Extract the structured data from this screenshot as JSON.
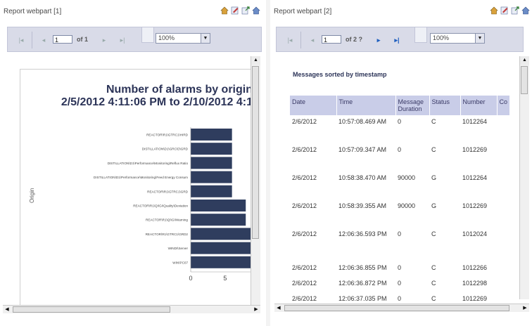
{
  "webpart1": {
    "title": "Report webpart [1]",
    "toolbar": {
      "first": "|◂",
      "prev": "◂",
      "page_value": "1",
      "of_label": "of 1",
      "next": "▸",
      "last": "▸|",
      "zoom": "100%"
    },
    "chart_data": {
      "type": "bar",
      "orientation": "horizontal",
      "title": "Number of alarms by origin",
      "subtitle": "2/5/2012 4:11:06 PM to 2/10/2012 4:1",
      "ylabel": "Origin",
      "categories": [
        "REACTOR\\R1\\GTRC1\\HIRD",
        "DISTILLATION\\D1\\GRC\\D\\GRD",
        "DISTILLATION\\D1\\Performance\\Monitoring\\Reflux Ratio",
        "DISTILLATION\\D1\\Performance\\Monitoring\\Feed Energy Consum",
        "REACTOR\\R1\\GTRC1\\GRD",
        "REACTOR\\R1\\QI\\GI\\Quality\\Deviation",
        "REACTOR\\R1\\QI\\GI\\Warning",
        "REACTOR\\R1\\GTRC1\\GRD2",
        "WINDI\\Server",
        "WIN\\PC07"
      ],
      "values": [
        6,
        6,
        6,
        6,
        6,
        8,
        8,
        9,
        9,
        9
      ],
      "xticks": [
        "0",
        "5"
      ],
      "xlim": [
        0,
        9
      ],
      "bar_color": "#2f3d5e"
    }
  },
  "webpart2": {
    "title": "Report webpart [2]",
    "toolbar": {
      "first": "|◂",
      "prev": "◂",
      "page_value": "1",
      "of_label": "of 2 ?",
      "next": "▸",
      "last": "▸|",
      "zoom": "100%"
    },
    "report_title": "Messages sorted by timestamp",
    "table": {
      "headers": [
        "Date",
        "Time",
        "Message Duration",
        "Status",
        "Number",
        "Co"
      ],
      "rows": [
        [
          "2/6/2012",
          "10:57:08.469 AM",
          "0",
          "C",
          "1012264"
        ],
        [
          "2/6/2012",
          "10:57:09.347 AM",
          "0",
          "C",
          "1012269"
        ],
        [
          "2/6/2012",
          "10:58:38.470 AM",
          "90000",
          "G",
          "1012264"
        ],
        [
          "2/6/2012",
          "10:58:39.355 AM",
          "90000",
          "G",
          "1012269"
        ],
        [
          "2/6/2012",
          "12:06:36.593 PM",
          "0",
          "C",
          "1012024"
        ],
        [
          "2/6/2012",
          "12:06:36.855 PM",
          "0",
          "C",
          "1012266"
        ],
        [
          "2/6/2012",
          "12:06:36.872 PM",
          "0",
          "C",
          "1012298"
        ],
        [
          "2/6/2012",
          "12:06:37.035 PM",
          "0",
          "C",
          "1012269"
        ]
      ]
    }
  },
  "colors": {
    "toolbar_bg": "#d9dbe8",
    "header_bg": "#c9cde8",
    "title_color": "#2c3458",
    "bar_color": "#2f3d5e"
  }
}
